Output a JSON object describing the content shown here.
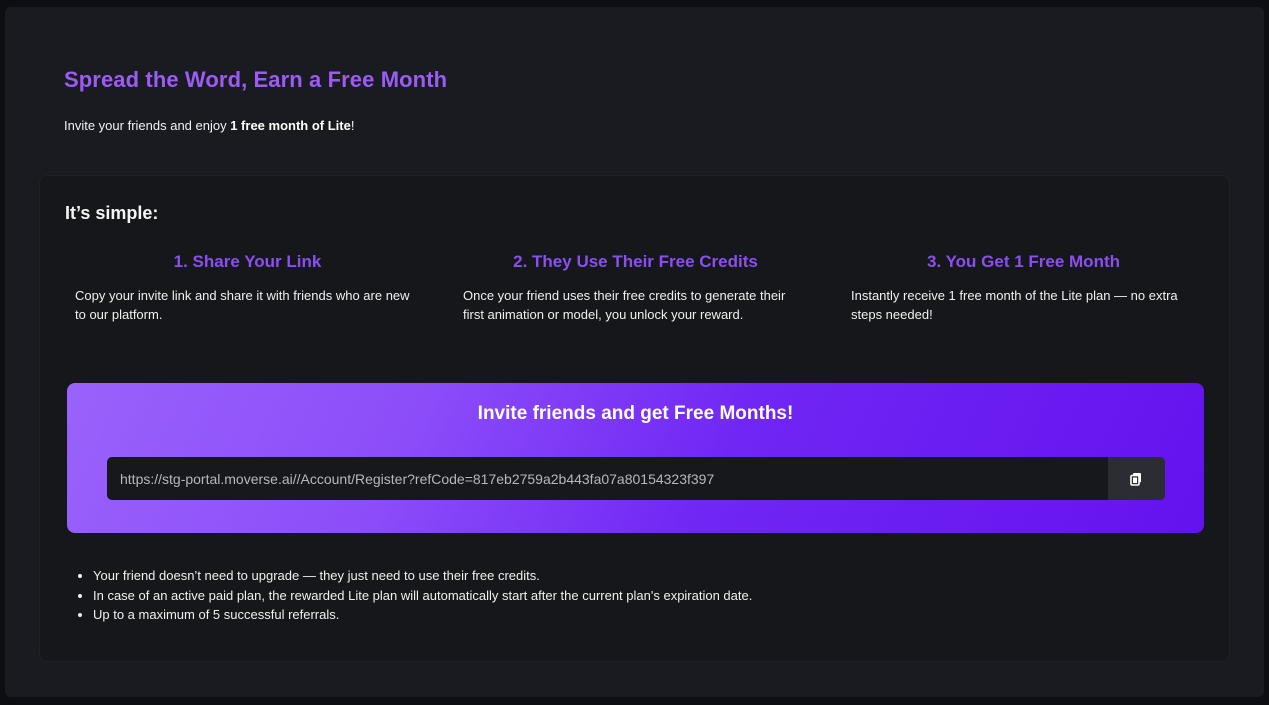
{
  "header": {
    "title": "Spread the Word, Earn a Free Month",
    "subtitle_prefix": "Invite your friends and enjoy ",
    "subtitle_bold": "1 free month of Lite",
    "subtitle_suffix": "!"
  },
  "how_it_works": {
    "heading": "It’s simple:",
    "steps": [
      {
        "title": "1. Share Your Link",
        "description": "Copy your invite link and share it with friends who are new to our platform."
      },
      {
        "title": "2. They Use Their Free Credits",
        "description": "Once your friend uses their free credits to generate their first animation or model, you unlock your reward."
      },
      {
        "title": "3. You Get 1 Free Month",
        "description": "Instantly receive 1 free month of the Lite plan — no extra steps needed!"
      }
    ]
  },
  "invite": {
    "title": "Invite friends and get Free Months!",
    "link": "https://stg-portal.moverse.ai//Account/Register?refCode=817eb2759a2b443fa07a80154323f397",
    "copy_icon": "copy-icon"
  },
  "notes": [
    "Your friend doesn’t need to upgrade — they just need to use their free credits.",
    "In case of an active paid plan, the rewarded Lite plan will automatically start after the current plan's expiration date.",
    "Up to a maximum of 5 successful referrals."
  ],
  "colors": {
    "accent": "#9b5cf5",
    "step_title": "#8b4ff0",
    "banner_start": "#9a62fb",
    "banner_end": "#6412ee",
    "background": "#1a1b20"
  }
}
